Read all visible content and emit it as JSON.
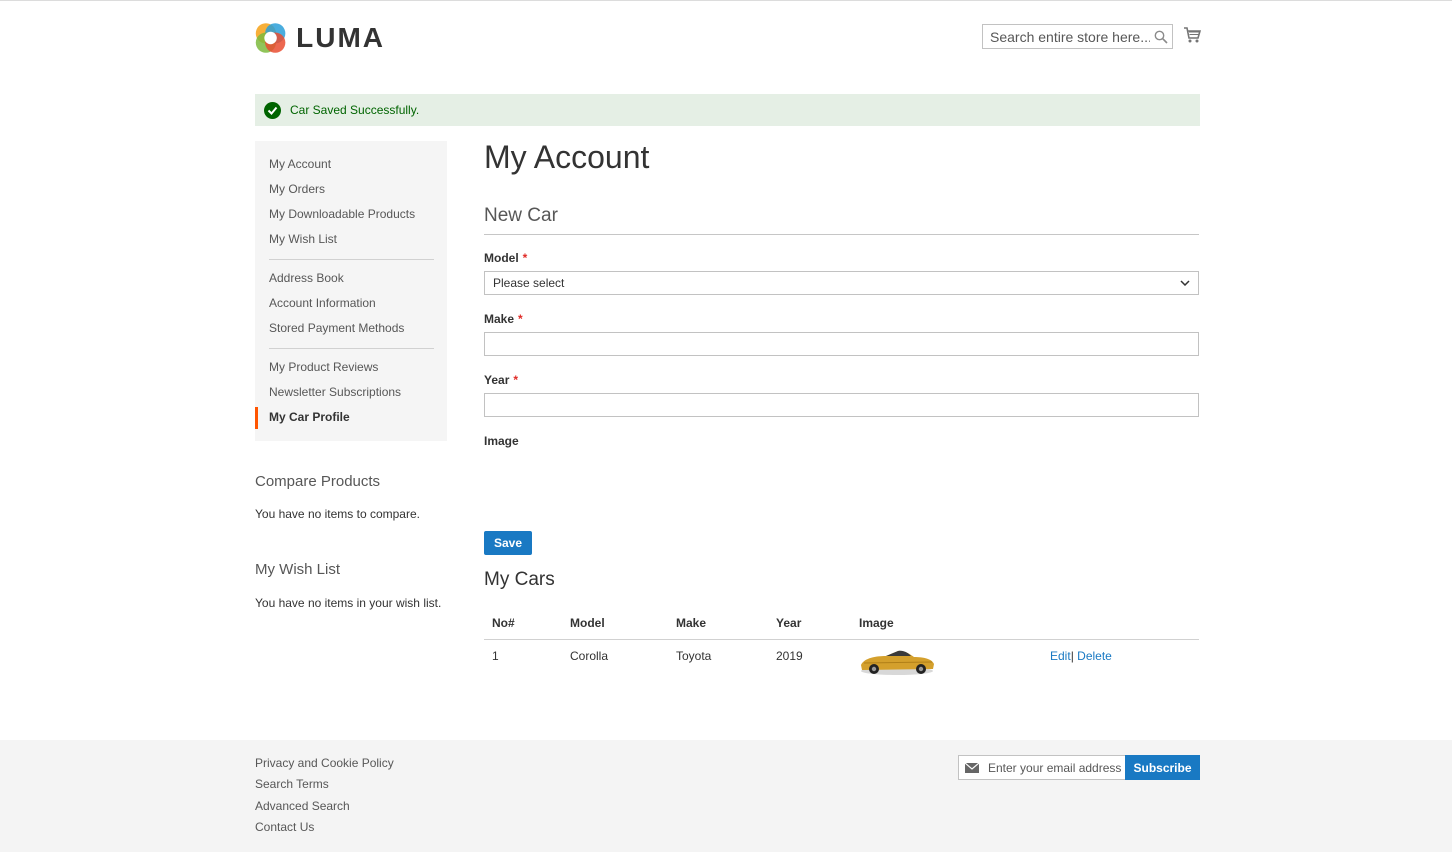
{
  "header": {
    "logo_text": "LUMA",
    "search_placeholder": "Search entire store here...",
    "search_icon": "search-icon",
    "cart_icon": "cart-icon"
  },
  "message": {
    "text": "Car Saved Successfully.",
    "icon": "check-circle-icon",
    "color": "#006400"
  },
  "sidebar": {
    "groups": [
      [
        "My Account",
        "My Orders",
        "My Downloadable Products",
        "My Wish List"
      ],
      [
        "Address Book",
        "Account Information",
        "Stored Payment Methods"
      ],
      [
        "My Product Reviews",
        "Newsletter Subscriptions",
        "My Car Profile"
      ]
    ],
    "active": "My Car Profile",
    "compare": {
      "title": "Compare Products",
      "text": "You have no items to compare."
    },
    "wishlist": {
      "title": "My Wish List",
      "text": "You have no items in your wish list."
    }
  },
  "main": {
    "page_title": "My Account",
    "form_title": "New Car",
    "fields": {
      "model": {
        "label": "Model",
        "value": "Please select"
      },
      "make": {
        "label": "Make",
        "value": ""
      },
      "year": {
        "label": "Year",
        "value": ""
      },
      "image": {
        "label": "Image"
      }
    },
    "save_label": "Save",
    "cars_title": "My Cars",
    "table": {
      "headers": [
        "No#",
        "Model",
        "Make",
        "Year",
        "Image"
      ],
      "rows": [
        {
          "no": "1",
          "model": "Corolla",
          "make": "Toyota",
          "year": "2019",
          "edit": "Edit",
          "sep": "|",
          "delete": "Delete"
        }
      ]
    }
  },
  "footer": {
    "links": [
      "Privacy and Cookie Policy",
      "Search Terms",
      "Advanced Search",
      "Contact Us"
    ],
    "newsletter_placeholder": "Enter your email address",
    "subscribe_label": "Subscribe",
    "mail_icon": "envelope-icon"
  },
  "colors": {
    "accent": "#1979c3",
    "active_bar": "#ff5501",
    "required": "#e02b27"
  }
}
